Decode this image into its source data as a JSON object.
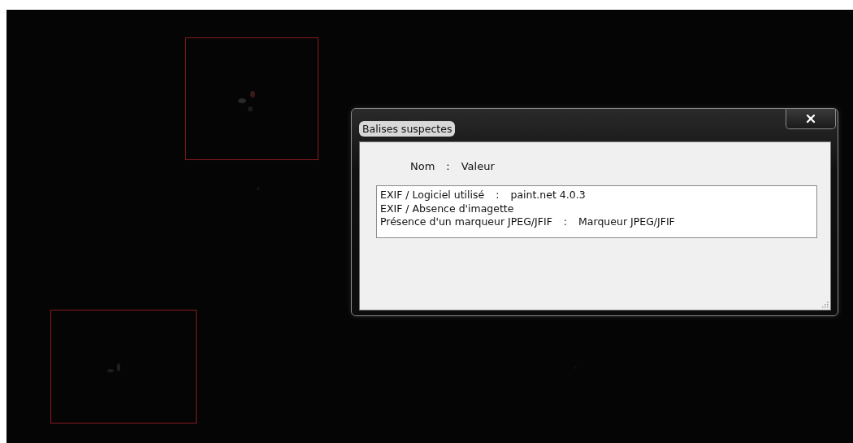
{
  "dialog": {
    "title": "Balises suspectes",
    "header": {
      "name_label": "Nom",
      "separator": ":",
      "value_label": "Valeur"
    },
    "rows": [
      {
        "name": "EXIF / Logiciel utilisé",
        "separator": ":",
        "value": "paint.net 4.0.3"
      },
      {
        "name": "EXIF / Absence d'imagette"
      },
      {
        "name": "Présence d'un marqueur JPEG/JFIF",
        "separator": ":",
        "value": "Marqueur JPEG/JFIF"
      }
    ]
  }
}
